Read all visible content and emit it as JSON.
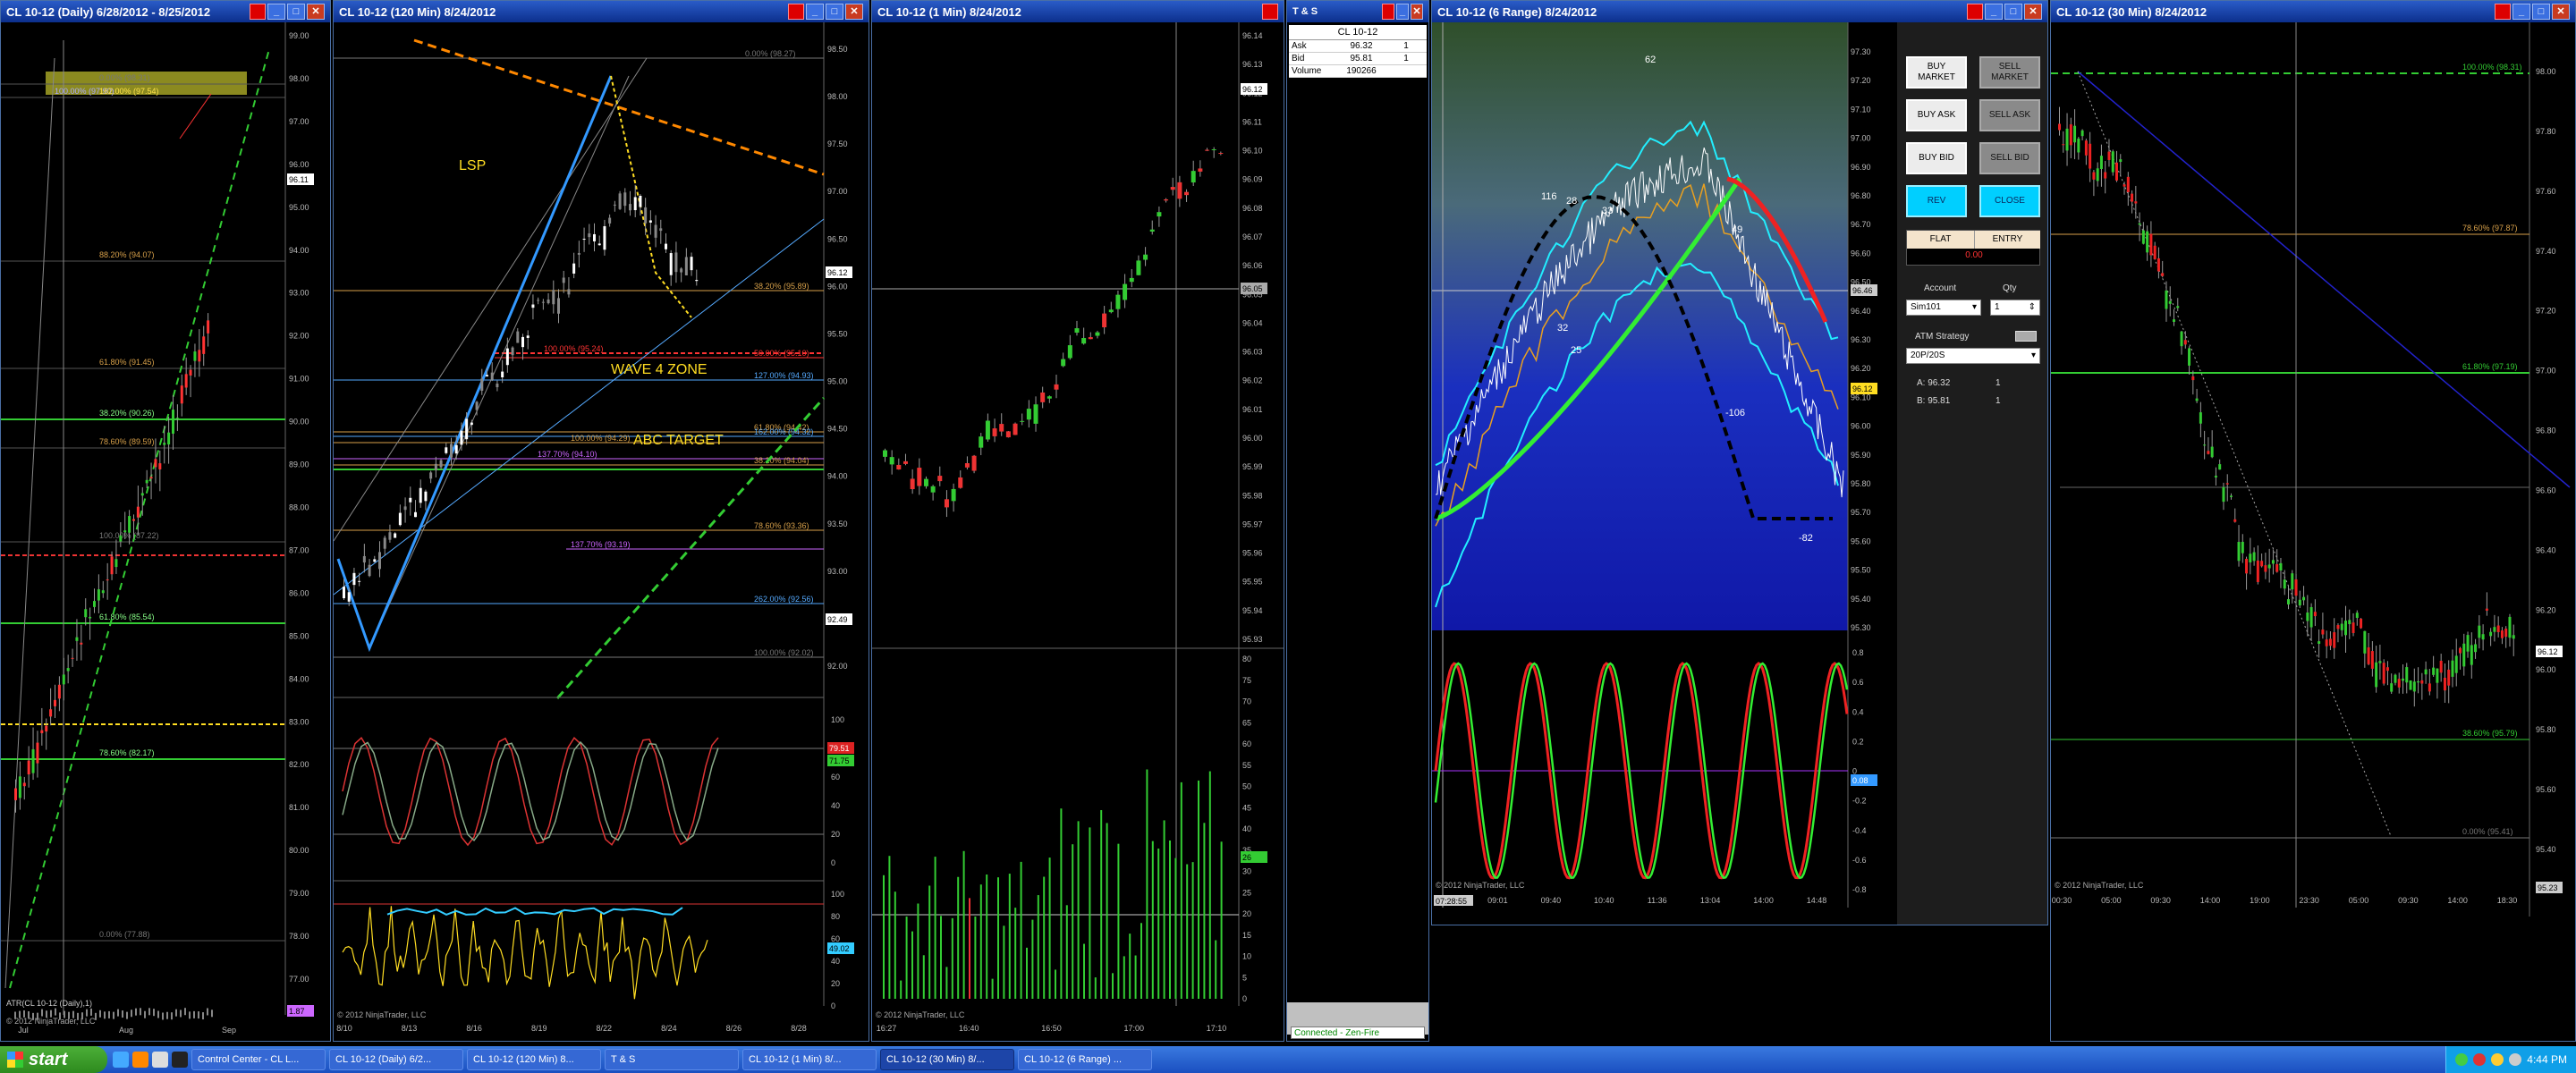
{
  "windows": {
    "daily": {
      "title": "CL 10-12 (Daily)  6/28/2012 - 8/25/2012",
      "bottom_indicator": "ATR(CL 10-12 (Daily),1)",
      "copyright": "© 2012 NinjaTrader, LLC",
      "x_labels": [
        "Jul",
        "Aug",
        "Sep"
      ],
      "y_labels": [
        "99.00",
        "98.00",
        "97.00",
        "96.00",
        "95.00",
        "94.00",
        "93.00",
        "92.00",
        "91.00",
        "90.00",
        "89.00",
        "88.00",
        "87.00",
        "86.00",
        "85.00",
        "84.00",
        "83.00",
        "82.00",
        "81.00",
        "80.00",
        "79.00",
        "78.00",
        "77.00"
      ],
      "price_box": "96.11",
      "atr_box": "1.87",
      "fib_labels": [
        "100.00% (97.90)",
        "162.00% (97.54)",
        "0.00% (98.31)",
        "88.20% (94.07)",
        "61.80% (91.45)",
        "38.20% (90.26)",
        "78.60% (89.59)",
        "100.00% (87.22)",
        "61.80% (85.54)",
        "78.60% (82.17)",
        "0.00% (77.88)"
      ]
    },
    "min120": {
      "title": "CL 10-12 (120 Min)  8/24/2012",
      "copyright": "© 2012 NinjaTrader, LLC",
      "x_labels": [
        "8/10",
        "8/13",
        "8/16",
        "8/19",
        "8/22",
        "8/24",
        "8/26",
        "8/28"
      ],
      "y_labels": [
        "98.50",
        "98.00",
        "97.50",
        "97.00",
        "96.50",
        "96.00",
        "95.50",
        "95.00",
        "94.50",
        "94.00",
        "93.50",
        "93.00",
        "92.50",
        "92.00"
      ],
      "price_box": "96.12",
      "low_box": "92.49",
      "annotations": {
        "lsp": "LSP",
        "wave4": "WAVE 4 ZONE",
        "abc": "ABC TARGET"
      },
      "fib_labels": [
        "0.00% (98.27)",
        "38.20% (95.89)",
        "100.00% (95.24)",
        "50.00% (95.10)",
        "127.00% (94.93)",
        "61.80% (94.42)",
        "162.00% (94.32)",
        "100.00% (94.29)",
        "137.70% (94.10)",
        "38.20% (94.04)",
        "78.60% (93.36)",
        "137.70% (93.19)",
        "262.00% (92.56)",
        "100.00% (92.02)"
      ],
      "stoch_y": [
        "100",
        "80",
        "60",
        "40",
        "20",
        "0"
      ],
      "stoch_box1": "79.51",
      "stoch_box2": "71.75",
      "rsi_y": [
        "100",
        "80",
        "60",
        "40",
        "20",
        "0"
      ],
      "rsi_box": "49.02"
    },
    "min1": {
      "title": "CL 10-12 (1 Min)  8/24/2012",
      "copyright": "© 2012 NinjaTrader, LLC",
      "x_labels": [
        "16:27",
        "16:40",
        "16:50",
        "17:00",
        "17:10"
      ],
      "y_labels": [
        "96.14",
        "96.13",
        "96.12",
        "96.11",
        "96.10",
        "96.09",
        "96.08",
        "96.07",
        "96.06",
        "96.05",
        "96.04",
        "96.03",
        "96.02",
        "96.01",
        "96.00",
        "95.99",
        "95.98",
        "95.97",
        "95.96",
        "95.95",
        "95.94",
        "95.93"
      ],
      "price_box": "96.12",
      "cross_box": "96.05",
      "vol_y": [
        "80",
        "75",
        "70",
        "65",
        "60",
        "55",
        "50",
        "45",
        "40",
        "35",
        "30",
        "25",
        "20",
        "15",
        "10",
        "5",
        "0"
      ],
      "vol_box": "26"
    },
    "tns": {
      "title": "T & S",
      "instrument": "CL 10-12",
      "rows": [
        {
          "label": "Ask",
          "price": "96.32",
          "size": "1"
        },
        {
          "label": "Bid",
          "price": "95.81",
          "size": "1"
        },
        {
          "label": "Volume",
          "price": "190266",
          "size": ""
        }
      ],
      "status": "Connected - Zen-Fire"
    },
    "range6": {
      "title": "CL 10-12 (6 Range)  8/24/2012",
      "copyright": "© 2012 NinjaTrader, LLC",
      "x_labels": [
        "08:27",
        "09:01",
        "09:40",
        "10:40",
        "11:36",
        "13:04",
        "14:00",
        "14:48"
      ],
      "start_box": "07:28:55",
      "y_labels": [
        "97.30",
        "97.20",
        "97.10",
        "97.00",
        "96.90",
        "96.80",
        "96.70",
        "96.60",
        "96.50",
        "96.40",
        "96.30",
        "96.20",
        "96.10",
        "96.00",
        "95.90",
        "95.80",
        "95.70",
        "95.60",
        "95.50",
        "95.40",
        "95.30"
      ],
      "price_box": "96.12",
      "gray_box": "96.46",
      "osc_y": [
        "0.8",
        "0.6",
        "0.4",
        "0.2",
        "0",
        "-0.2",
        "-0.4",
        "-0.6",
        "-0.8"
      ],
      "osc_box": "0.08",
      "numbers": [
        "62",
        "116",
        "28",
        "33",
        "32",
        "25",
        "49",
        "-106",
        "-82"
      ]
    },
    "min30": {
      "title": "CL 10-12 (30 Min)  8/24/2012",
      "copyright": "© 2012 NinjaTrader, LLC",
      "x_labels": [
        "00:30",
        "05:00",
        "09:30",
        "14:00",
        "19:00",
        "23:30",
        "05:00",
        "09:30",
        "14:00",
        "18:30"
      ],
      "y_labels": [
        "98.00",
        "97.80",
        "97.60",
        "97.40",
        "97.20",
        "97.00",
        "96.80",
        "96.60",
        "96.40",
        "96.20",
        "96.00",
        "95.80",
        "95.60",
        "95.40"
      ],
      "price_box": "96.12",
      "low_box": "95.23",
      "fib_labels": [
        "100.00% (98.31)",
        "78.60% (97.87)",
        "61.80% (97.19)",
        "38.60% (95.79)",
        "0.00% (95.41)"
      ]
    }
  },
  "order_panel": {
    "buttons": {
      "buy_market": "BUY MARKET",
      "sell_market": "SELL MARKET",
      "buy_ask": "BUY ASK",
      "sell_ask": "SELL ASK",
      "buy_bid": "BUY BID",
      "sell_bid": "SELL BID",
      "rev": "REV",
      "close": "CLOSE",
      "flat": "FLAT",
      "entry": "ENTRY"
    },
    "pnl": "0.00",
    "account_label": "Account",
    "account_value": "Sim101",
    "qty_label": "Qty",
    "qty_value": "1",
    "atm_label": "ATM Strategy",
    "atm_value": "20P/20S",
    "ask_line": "A: 96.32",
    "ask_qty": "1",
    "bid_line": "B: 95.81",
    "bid_qty": "1"
  },
  "taskbar": {
    "start": "start",
    "tasks": [
      "Control Center - CL L...",
      "CL 10-12 (Daily)  6/2...",
      "CL 10-12 (120 Min)  8...",
      "T & S",
      "CL 10-12 (1 Min)  8/...",
      "CL 10-12 (30 Min)  8/...",
      "CL 10-12 (6 Range) ..."
    ],
    "clock": "4:44 PM"
  }
}
